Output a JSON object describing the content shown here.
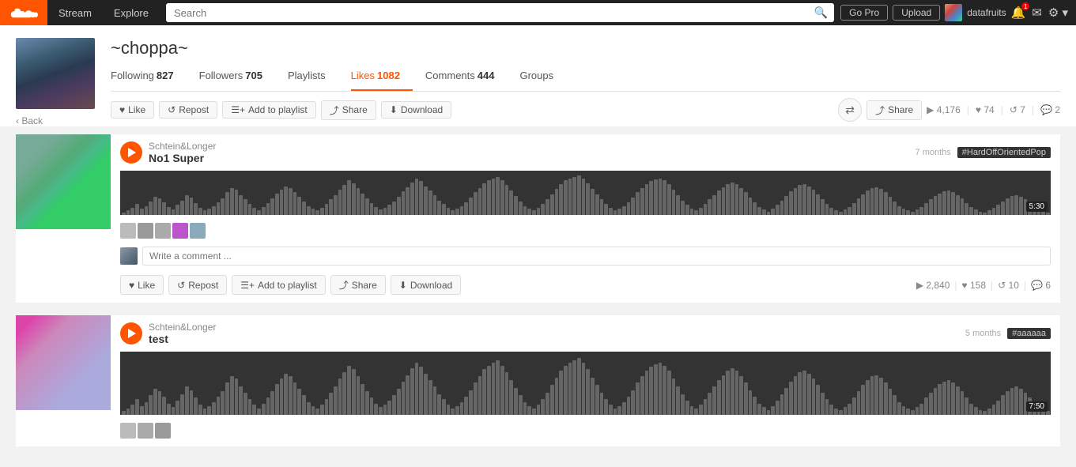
{
  "topnav": {
    "stream_label": "Stream",
    "explore_label": "Explore",
    "search_placeholder": "Search",
    "gopro_label": "Go Pro",
    "upload_label": "Upload",
    "username": "datafruits",
    "settings_label": "⚙",
    "notification_count": "1"
  },
  "profile": {
    "name": "~choppa~",
    "back_label": "Back",
    "following_label": "Following",
    "following_count": "827",
    "followers_label": "Followers",
    "followers_count": "705",
    "playlists_label": "Playlists",
    "likes_label": "Likes",
    "likes_count": "1082",
    "comments_label": "Comments",
    "comments_count": "444",
    "groups_label": "Groups"
  },
  "action_bar_1": {
    "like_label": "Like",
    "repost_label": "Repost",
    "add_to_playlist_label": "Add to playlist",
    "share_label": "Share",
    "download_label": "Download",
    "plays": "4,176",
    "likes": "74",
    "reposts": "7",
    "comments": "2"
  },
  "tracks": [
    {
      "id": "track1",
      "artist": "Schtein&Longer",
      "title": "No1 Super",
      "age": "7 months",
      "tag": "#HardOffOrientedPop",
      "duration": "5:30",
      "plays": "2,840",
      "likes": "158",
      "reposts": "10",
      "comments": "6",
      "comment_placeholder": "Write a comment ...",
      "like_label": "Like",
      "repost_label": "Repost",
      "add_to_playlist_label": "Add to playlist",
      "share_label": "Share",
      "download_label": "Download"
    },
    {
      "id": "track2",
      "artist": "Schtein&Longer",
      "title": "test",
      "age": "5 months",
      "tag": "#aaaaaa",
      "duration": "7:50",
      "plays": "",
      "likes": "",
      "reposts": "",
      "comments": ""
    }
  ],
  "waveform_bars": [
    3,
    5,
    8,
    12,
    7,
    10,
    15,
    20,
    18,
    14,
    9,
    6,
    11,
    16,
    22,
    19,
    13,
    8,
    5,
    7,
    10,
    14,
    18,
    25,
    30,
    28,
    22,
    17,
    12,
    8,
    5,
    9,
    13,
    18,
    24,
    28,
    32,
    30,
    25,
    20,
    15,
    10,
    7,
    5,
    8,
    12,
    17,
    22,
    28,
    33,
    38,
    35,
    30,
    24,
    18,
    13,
    9,
    6,
    8,
    11,
    15,
    20,
    26,
    31,
    36,
    40,
    37,
    32,
    27,
    22,
    16,
    12,
    8,
    5,
    7,
    10,
    14,
    19,
    25,
    30,
    35,
    38,
    40,
    42,
    38,
    33,
    27,
    21,
    15,
    10,
    7,
    5,
    8,
    12,
    17,
    23,
    29,
    34,
    38,
    40,
    42,
    44,
    40,
    35,
    29,
    23,
    17,
    12,
    8,
    5,
    7,
    10,
    14,
    19,
    25,
    30,
    34,
    37,
    39,
    40,
    38,
    34,
    28,
    22,
    16,
    11,
    7,
    5,
    8,
    12,
    17,
    22,
    27,
    31,
    34,
    36,
    34,
    30,
    25,
    19,
    14,
    9,
    6,
    4,
    7,
    11,
    16,
    21,
    26,
    30,
    33,
    34,
    32,
    28,
    23,
    17,
    12,
    8,
    5,
    4,
    6,
    9,
    13,
    18,
    23,
    27,
    30,
    31,
    29,
    25,
    20,
    15,
    10,
    7,
    5,
    4,
    6,
    9,
    13,
    17,
    21,
    24,
    26,
    27,
    25,
    22,
    18,
    13,
    9,
    6,
    4,
    3,
    5,
    8,
    11,
    15,
    18,
    21,
    22,
    20,
    17,
    13,
    9,
    6,
    4,
    3
  ]
}
